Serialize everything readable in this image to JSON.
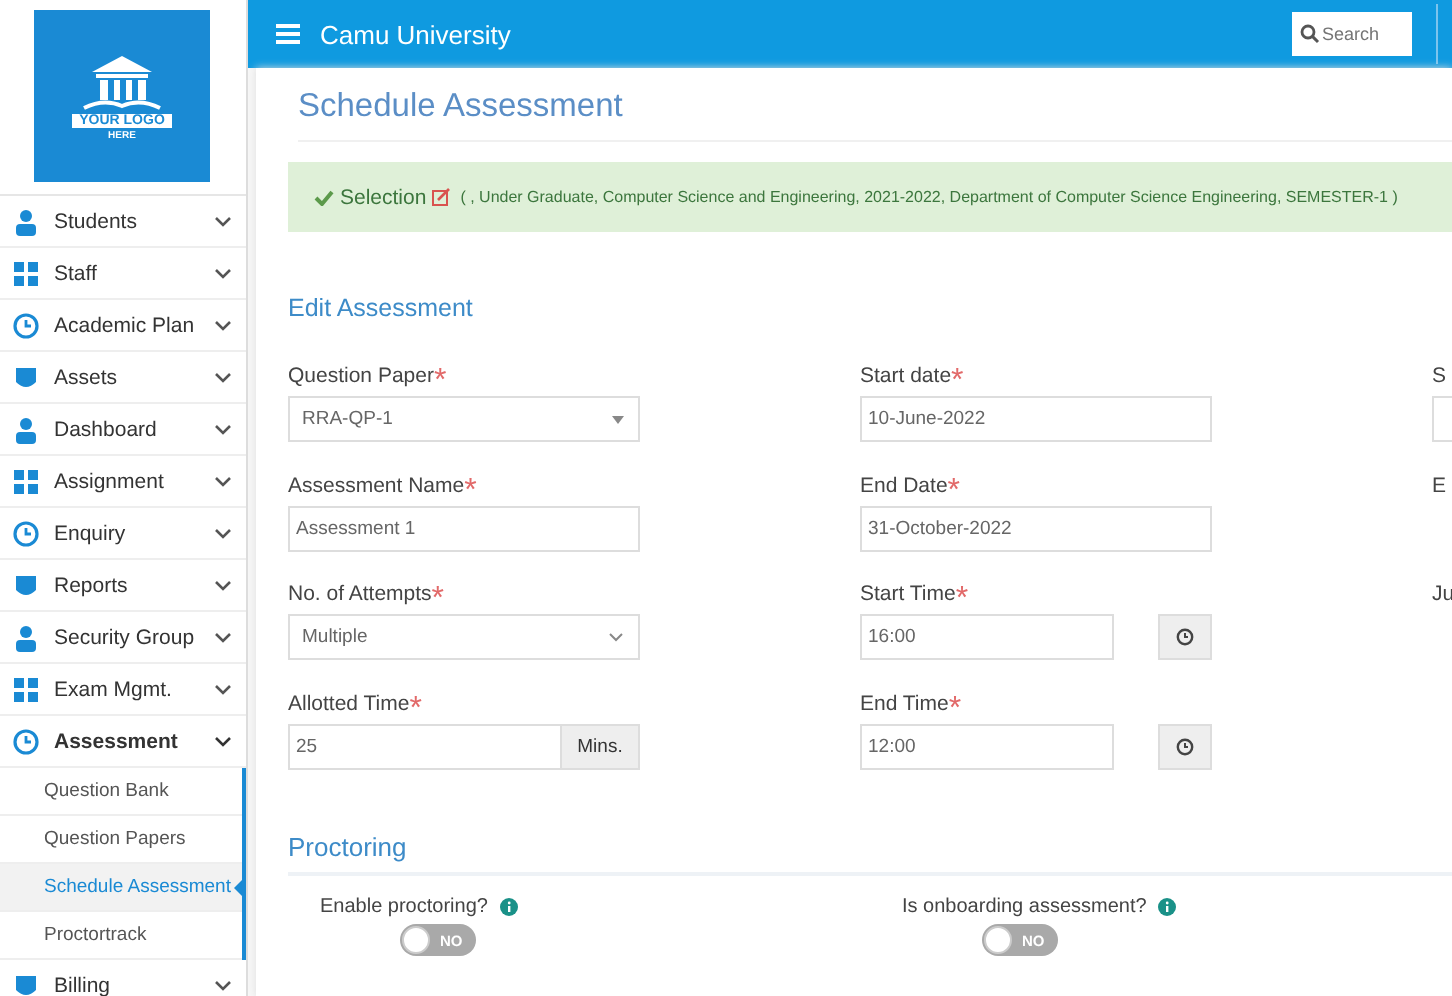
{
  "logo": {
    "line_1": "YOUR LOGO",
    "line_2": "HERE"
  },
  "sidebar": {
    "items": [
      {
        "label": "Students",
        "expanded": false
      },
      {
        "label": "Staff",
        "expanded": false
      },
      {
        "label": "Academic Plan",
        "expanded": false
      },
      {
        "label": "Assets",
        "expanded": false
      },
      {
        "label": "Dashboard",
        "expanded": false
      },
      {
        "label": "Assignment",
        "expanded": false
      },
      {
        "label": "Enquiry",
        "expanded": false
      },
      {
        "label": "Reports",
        "expanded": false
      },
      {
        "label": "Security Group",
        "expanded": false
      },
      {
        "label": "Exam Mgmt.",
        "expanded": false
      },
      {
        "label": "Assessment",
        "expanded": true,
        "children": [
          {
            "label": "Question Bank",
            "selected": false
          },
          {
            "label": "Question Papers",
            "selected": false
          },
          {
            "label": "Schedule Assessment",
            "selected": true
          },
          {
            "label": "Proctortrack",
            "selected": false
          }
        ]
      },
      {
        "label": "Billing",
        "expanded": false
      }
    ]
  },
  "header": {
    "title": "Camu University",
    "search": {
      "placeholder": "Search"
    }
  },
  "page_title": "Schedule Assessment",
  "selection": {
    "label": "Selection",
    "details": "( , Under Graduate, Computer Science and Engineering, 2021-2022, Department of Computer Science Engineering, SEMESTER-1 )"
  },
  "section_title": "Edit Assessment",
  "columns": [
    [
      {
        "kind": "dropdown",
        "label": "Question Paper",
        "required_mark": "*",
        "value": "RRA-QP-1"
      },
      {
        "kind": "text",
        "label": "Assessment Name",
        "required_mark": "*",
        "value": "Assessment 1"
      },
      {
        "kind": "select",
        "label": "No. of Attempts",
        "required_mark": "*",
        "value": "Multiple"
      },
      {
        "kind": "addon",
        "label": "Allotted Time",
        "required_mark": "*",
        "value": "25",
        "addon": "Mins."
      }
    ],
    [
      {
        "kind": "text",
        "label": "Start date",
        "required_mark": "*",
        "value": "10-June-2022"
      },
      {
        "kind": "text",
        "label": "End Date",
        "required_mark": "*",
        "value": "31-October-2022"
      },
      {
        "kind": "time",
        "label": "Start Time",
        "required_mark": "*",
        "value": "16:00"
      },
      {
        "kind": "time",
        "label": "End Time",
        "required_mark": "*",
        "value": "12:00"
      }
    ],
    [
      {
        "kind": "text",
        "label": "S"
      },
      {
        "kind": "none",
        "label": "E"
      },
      {
        "kind": "none",
        "label": "Ju"
      }
    ]
  ],
  "proctoring": {
    "title": "Proctoring",
    "toggles": [
      {
        "label": "Enable proctoring?",
        "on": false,
        "state_text": "NO"
      },
      {
        "label": "Is onboarding assessment?",
        "on": false,
        "state_text": "NO"
      }
    ]
  }
}
